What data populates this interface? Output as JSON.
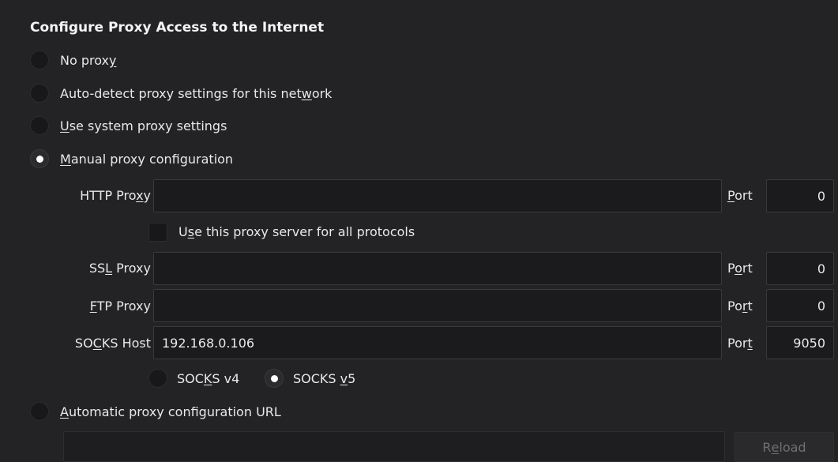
{
  "title": "Configure Proxy Access to the Internet",
  "modes": {
    "no_proxy": {
      "pre": "No prox",
      "key": "y",
      "post": ""
    },
    "auto_detect": {
      "pre": "Auto-detect proxy settings for this net",
      "key": "w",
      "post": "ork"
    },
    "system": {
      "pre": "",
      "key": "U",
      "post": "se system proxy settings"
    },
    "manual": {
      "pre": "",
      "key": "M",
      "post": "anual proxy configuration"
    },
    "auto_url": {
      "pre": "",
      "key": "A",
      "post": "utomatic proxy configuration URL"
    },
    "selected": "manual"
  },
  "http": {
    "label_pre": "HTTP Pro",
    "label_key": "x",
    "label_post": "y",
    "value": "",
    "port_label_key": "P",
    "port_label_post": "ort",
    "port": "0"
  },
  "all_protocols": {
    "pre": "U",
    "key": "s",
    "post": "e this proxy server for all protocols",
    "checked": false
  },
  "ssl": {
    "label_pre": "SS",
    "label_key": "L",
    "label_post": " Proxy",
    "value": "",
    "port_label_pre": "P",
    "port_label_key": "o",
    "port_label_post": "rt",
    "port": "0"
  },
  "ftp": {
    "label_pre": "",
    "label_key": "F",
    "label_post": "TP Proxy",
    "value": "",
    "port_label_pre": "Po",
    "port_label_key": "r",
    "port_label_post": "t",
    "port": "0"
  },
  "socks": {
    "label_pre": "SO",
    "label_key": "C",
    "label_post": "KS Host",
    "value": "192.168.0.106",
    "port_label_pre": "Por",
    "port_label_key": "t",
    "port": "9050"
  },
  "socks_version": {
    "v4": {
      "pre": "SOC",
      "key": "K",
      "post": "S v4"
    },
    "v5": {
      "pre": "SOCKS ",
      "key": "v",
      "post": "5"
    },
    "selected": "v5"
  },
  "auto_url_value": "",
  "reload": {
    "pre": "R",
    "key": "e",
    "post": "load"
  }
}
